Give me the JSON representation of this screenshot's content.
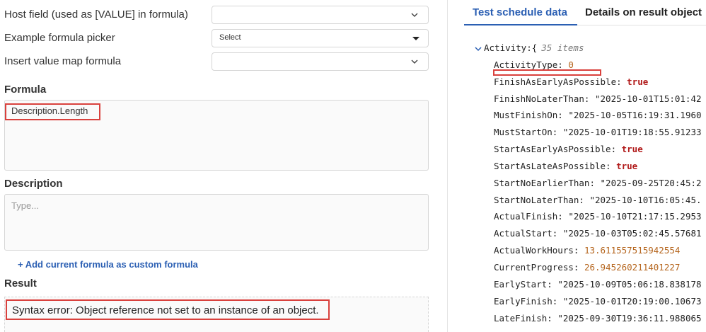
{
  "form": {
    "host_field_label": "Host field (used as [VALUE] in formula)",
    "host_field_value": "",
    "example_picker_label": "Example formula picker",
    "example_picker_value": "Select",
    "value_map_label": "Insert value map formula",
    "value_map_value": "",
    "formula_label": "Formula",
    "formula_value": "Description.Length",
    "description_label": "Description",
    "description_placeholder": "Type...",
    "add_custom_link": "+ Add current formula as custom formula",
    "result_label": "Result",
    "result_value": "Syntax error: Object reference not set to an instance of an object."
  },
  "tabs": [
    {
      "label": "Test schedule data",
      "active": true
    },
    {
      "label": "Details on result object",
      "active": false
    }
  ],
  "json_tree": {
    "root_key": "Activity:",
    "root_brace": "{",
    "root_count": "35 items",
    "rows": [
      {
        "key": "ActivityType:",
        "value": "0",
        "type": "num"
      },
      {
        "key": "FinishAsEarlyAsPossible:",
        "value": "true",
        "type": "bool"
      },
      {
        "key": "FinishNoLaterThan:",
        "value": "\"2025-10-01T15:01:42",
        "type": "str"
      },
      {
        "key": "MustFinishOn:",
        "value": "\"2025-10-05T16:19:31.1960",
        "type": "str"
      },
      {
        "key": "MustStartOn:",
        "value": "\"2025-10-01T19:18:55.91233",
        "type": "str"
      },
      {
        "key": "StartAsEarlyAsPossible:",
        "value": "true",
        "type": "bool"
      },
      {
        "key": "StartAsLateAsPossible:",
        "value": "true",
        "type": "bool"
      },
      {
        "key": "StartNoEarlierThan:",
        "value": "\"2025-09-25T20:45:2",
        "type": "str"
      },
      {
        "key": "StartNoLaterThan:",
        "value": "\"2025-10-10T16:05:45.",
        "type": "str"
      },
      {
        "key": "ActualFinish:",
        "value": "\"2025-10-10T21:17:15.2953",
        "type": "str"
      },
      {
        "key": "ActualStart:",
        "value": "\"2025-10-03T05:02:45.57681",
        "type": "str"
      },
      {
        "key": "ActualWorkHours:",
        "value": "13.611557515942554",
        "type": "num"
      },
      {
        "key": "CurrentProgress:",
        "value": "26.945260211401227",
        "type": "num"
      },
      {
        "key": "EarlyStart:",
        "value": "\"2025-10-09T05:06:18.838178",
        "type": "str"
      },
      {
        "key": "EarlyFinish:",
        "value": "\"2025-10-01T20:19:00.10673",
        "type": "str"
      },
      {
        "key": "LateFinish:",
        "value": "\"2025-09-30T19:36:11.988065",
        "type": "str"
      }
    ]
  },
  "colors": {
    "accent": "#2b5fb3",
    "highlight_red": "#d9413d",
    "number": "#b5651d",
    "boolean": "#b11a1a"
  }
}
